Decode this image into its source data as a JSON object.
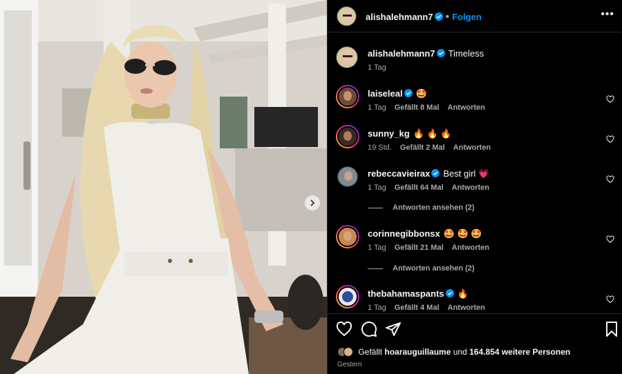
{
  "post": {
    "author": "alishalehmann7",
    "follow_label": "Folgen",
    "more_label": "•••",
    "caption": "Timeless",
    "caption_time": "1 Tag"
  },
  "comments": [
    {
      "user": "laiseleal",
      "verified": true,
      "text": "🤩",
      "time": "1 Tag",
      "likes": "Gefällt 8 Mal",
      "reply": "Antworten",
      "replies_label": ""
    },
    {
      "user": "sunny_kg",
      "verified": false,
      "text": "🔥 🔥 🔥",
      "time": "19 Std.",
      "likes": "Gefällt 2 Mal",
      "reply": "Antworten",
      "replies_label": ""
    },
    {
      "user": "rebeccavieirax",
      "verified": true,
      "text": "Best girl 💗",
      "time": "1 Tag",
      "likes": "Gefällt 64 Mal",
      "reply": "Antworten",
      "replies_label": "Antworten ansehen (2)"
    },
    {
      "user": "corinnegibbonsx",
      "verified": false,
      "text": "🤩 🤩 🤩",
      "time": "1 Tag",
      "likes": "Gefällt 21 Mal",
      "reply": "Antworten",
      "replies_label": "Antworten ansehen (2)"
    },
    {
      "user": "thebahamaspants",
      "verified": true,
      "text": "🔥",
      "time": "1 Tag",
      "likes": "Gefällt 4 Mal",
      "reply": "Antworten",
      "replies_label": ""
    }
  ],
  "likes_line": {
    "prefix": "Gefällt",
    "user": "hoarauguillaume",
    "middle": "und",
    "count": "164.854 weitere Personen"
  },
  "date": "Gestern",
  "colors": {
    "accent": "#0095f6",
    "verified": "#0095f6",
    "muted": "#a8a8a8",
    "border": "#262626"
  },
  "icons": [
    "heart-icon",
    "comment-icon",
    "share-icon",
    "bookmark-icon",
    "verified-icon",
    "chevron-right-icon",
    "more-icon"
  ]
}
